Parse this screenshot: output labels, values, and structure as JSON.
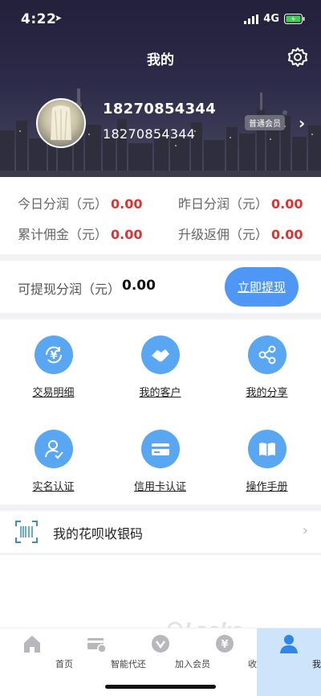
{
  "status_bar": {
    "time": "4:22",
    "network": "4G"
  },
  "header": {
    "title": "我的"
  },
  "profile": {
    "phone_primary": "18270854344",
    "phone_secondary": "18270854344",
    "member_level": "普通会员"
  },
  "earnings": {
    "today_label": "今日分润（元）",
    "today_value": "0.00",
    "yesterday_label": "昨日分润（元）",
    "yesterday_value": "0.00",
    "total_label": "累计佣金（元）",
    "total_value": "0.00",
    "upgrade_label": "升级返佣（元）",
    "upgrade_value": "0.00"
  },
  "withdraw": {
    "label": "可提现分润（元）",
    "value": "0.00",
    "button": "立即提现"
  },
  "menu": [
    {
      "label": "交易明细",
      "icon": "yen-cycle-icon"
    },
    {
      "label": "我的客户",
      "icon": "handshake-icon"
    },
    {
      "label": "我的分享",
      "icon": "share-icon"
    },
    {
      "label": "实名认证",
      "icon": "user-verify-icon"
    },
    {
      "label": "信用卡认证",
      "icon": "credit-card-icon"
    },
    {
      "label": "操作手册",
      "icon": "book-icon"
    }
  ],
  "huabei": {
    "label": "我的花呗收银码",
    "icon": "scan-code-icon"
  },
  "tabbar": [
    {
      "label": "首页",
      "icon": "home-icon"
    },
    {
      "label": "智能代还",
      "icon": "card-icon"
    },
    {
      "label": "加入会员",
      "icon": "member-icon"
    },
    {
      "label": "收款",
      "icon": "coin-icon"
    },
    {
      "label": "我的",
      "icon": "person-icon",
      "active": true
    }
  ],
  "colors": {
    "accent": "#4f97f5",
    "value_red": "#e03131",
    "icon_blue": "#59a6f2",
    "active_tab_bg": "#cde4fb"
  },
  "watermark": "Laoke .com 老客"
}
